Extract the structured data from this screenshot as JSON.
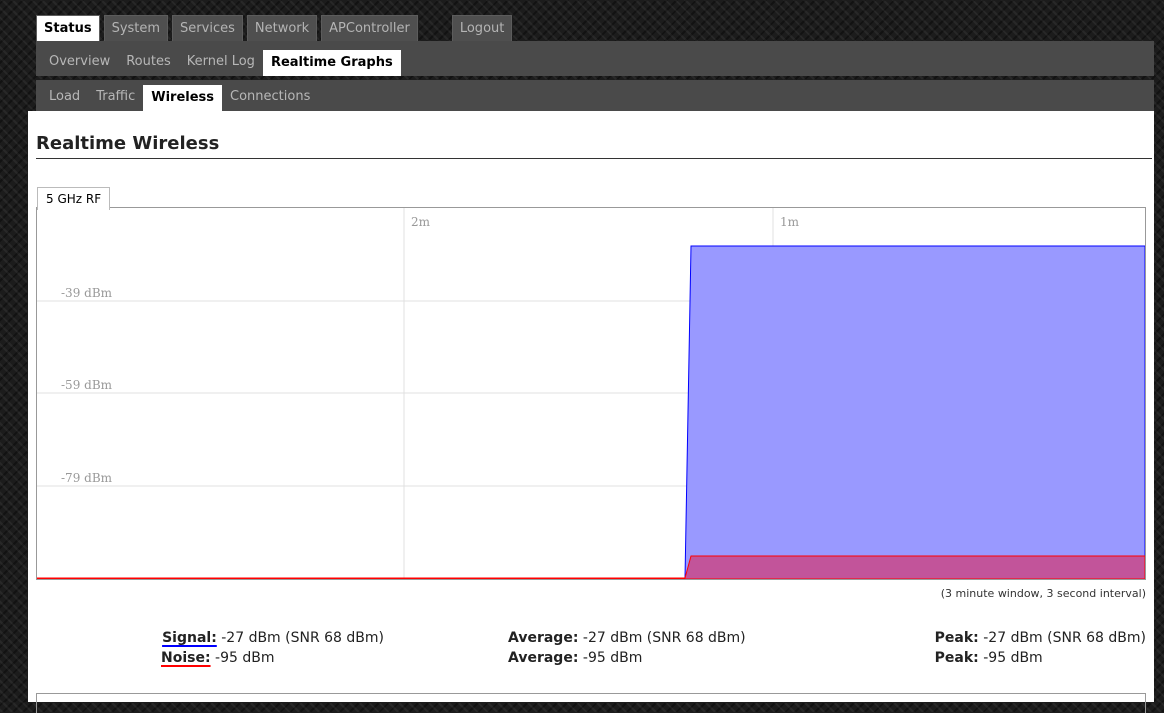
{
  "nav": {
    "top_tabs": [
      "Status",
      "System",
      "Services",
      "Network",
      "APController",
      "Logout"
    ],
    "sub_tabs": [
      "Overview",
      "Routes",
      "Kernel Log",
      "Realtime Graphs"
    ],
    "graph_tabs": [
      "Load",
      "Traffic",
      "Wireless",
      "Connections"
    ]
  },
  "page": {
    "title": "Realtime Wireless",
    "radio_tab": "5 GHz RF",
    "interval_note": "(3 minute window, 3 second interval)"
  },
  "chart_data": {
    "type": "area",
    "x_tick_labels": [
      "2m",
      "1m"
    ],
    "y_tick_labels": [
      "-39 dBm",
      "-59 dBm",
      "-79 dBm"
    ],
    "series": [
      {
        "name": "Signal",
        "color": "#0000ff",
        "fill": "#9999ff",
        "start_fraction": 0.59,
        "value_dbm": -27
      },
      {
        "name": "Noise",
        "color": "#ff0000",
        "fill": "#c2549a",
        "start_fraction": 0.59,
        "value_dbm": -95
      }
    ]
  },
  "stats": {
    "signal_label": "Signal:",
    "signal_value": "-27 dBm (SNR 68 dBm)",
    "noise_label": "Noise:",
    "noise_value": "-95 dBm",
    "avg_label": "Average:",
    "avg_signal": "-27 dBm (SNR 68 dBm)",
    "avg_noise": "-95 dBm",
    "peak_label": "Peak:",
    "peak_signal": "-27 dBm (SNR 68 dBm)",
    "peak_noise": "-95 dBm"
  },
  "colors": {
    "signal": "#0000ff",
    "noise": "#ff0000"
  }
}
